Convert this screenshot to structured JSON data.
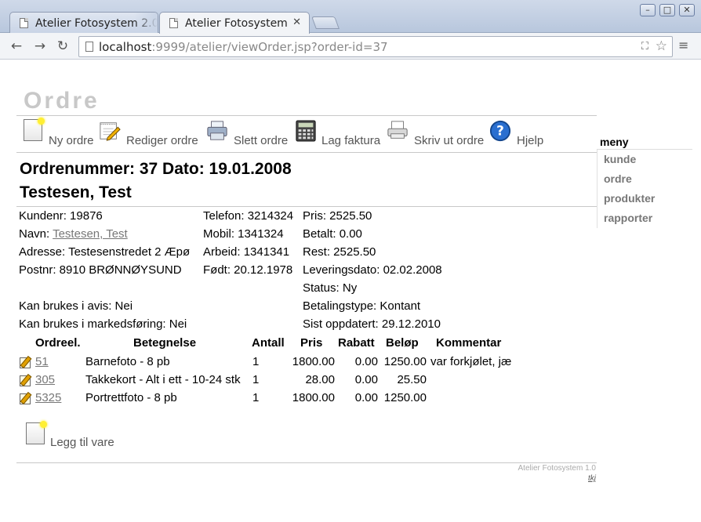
{
  "window": {
    "tabs": [
      {
        "title": "Atelier Fotosystem 2.0"
      },
      {
        "title": "Atelier Fotosystem"
      }
    ],
    "url_host": "localhost",
    "url_rest": ":9999/atelier/viewOrder.jsp?order-id=37"
  },
  "page": {
    "heading": "Ordre",
    "actions": {
      "new_order": "Ny ordre",
      "edit_order": "Rediger ordre",
      "delete_order": "Slett ordre",
      "make_invoice": "Lag faktura",
      "print_order": "Skriv ut ordre",
      "help": "Hjelp"
    },
    "menu": {
      "title": "meny",
      "items": [
        "kunde",
        "ordre",
        "produkter",
        "rapporter"
      ]
    },
    "order": {
      "title_line": "Ordrenummer: 37 Dato: 19.01.2008",
      "customer_name": "Testesen, Test"
    },
    "info": {
      "customer_no": "Kundenr: 19876",
      "name_label": "Navn: ",
      "name_link": "Testesen, Test",
      "address": "Adresse: Testesenstredet 2 Æpø",
      "postal": "Postnr: 8910 BRØNNØYSUND",
      "phone": "Telefon: 3214324",
      "mobile": "Mobil: 1341324",
      "work": "Arbeid: 1341341",
      "born": "Født: 20.12.1978",
      "price": "Pris: 2525.50",
      "paid": "Betalt: 0.00",
      "remaining": "Rest: 2525.50",
      "delivery": "Leveringsdato: 02.02.2008",
      "status": "Status: Ny",
      "payment_type": "Betalingstype: Kontant",
      "last_updated": "Sist oppdatert: 29.12.2010",
      "newspaper": "Kan brukes i avis: Nei",
      "marketing": "Kan brukes i markedsføring: Nei"
    },
    "table": {
      "headers": [
        "Ordreel.",
        "Betegnelse",
        "Antall",
        "Pris",
        "Rabatt",
        "Beløp",
        "Kommentar"
      ],
      "rows": [
        {
          "id": "51",
          "name": "Barnefoto - 8 pb",
          "qty": "1",
          "price": "1800.00",
          "discount": "0.00",
          "amount": "1250.00",
          "comment": "var forkjølet, jæ"
        },
        {
          "id": "305",
          "name": "Takkekort - Alt i ett - 10-24 stk",
          "qty": "1",
          "price": "28.00",
          "discount": "0.00",
          "amount": "25.50",
          "comment": ""
        },
        {
          "id": "5325",
          "name": "Portrettfoto - 8 pb",
          "qty": "1",
          "price": "1800.00",
          "discount": "0.00",
          "amount": "1250.00",
          "comment": ""
        }
      ]
    },
    "add_item": "Legg til vare",
    "footer": {
      "brand": "Atelier Fotosystem 1.0",
      "link": "tkj"
    }
  }
}
